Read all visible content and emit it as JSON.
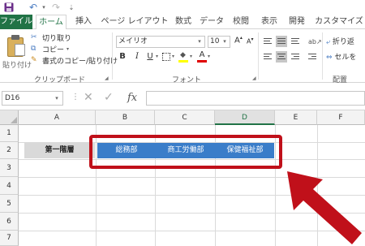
{
  "tabs": [
    {
      "label": "ファイル"
    },
    {
      "label": "ホーム"
    },
    {
      "label": "挿入"
    },
    {
      "label": "ページ レイアウト"
    },
    {
      "label": "数式"
    },
    {
      "label": "データ"
    },
    {
      "label": "校閲"
    },
    {
      "label": "表示"
    },
    {
      "label": "開発"
    },
    {
      "label": "カスタマイズ"
    }
  ],
  "clipboard": {
    "paste_label": "貼り付け",
    "cut_label": "切り取り",
    "copy_label": "コピー",
    "format_painter_label": "書式のコピー/貼り付け",
    "group_label": "クリップボード"
  },
  "font": {
    "name": "メイリオ",
    "size": "10",
    "grow": "A",
    "shrink": "A",
    "bold": "B",
    "italic": "I",
    "underline": "U",
    "color_letter": "A",
    "group_label": "フォント"
  },
  "alignment": {
    "wrap_label": "折り返",
    "merge_label": "セルを",
    "group_label": "配置"
  },
  "formula_bar": {
    "name_box": "D16",
    "cancel": "✕",
    "enter": "✓",
    "fx": "fx",
    "formula": ""
  },
  "grid": {
    "columns": [
      "A",
      "B",
      "C",
      "D",
      "E",
      "F"
    ],
    "rows": [
      "1",
      "2",
      "3",
      "4",
      "5",
      "6",
      "7"
    ],
    "cells": {
      "A2": "第一階層",
      "B2": "総務部",
      "C2": "商工労働部",
      "D2": "保健福祉部"
    }
  },
  "colors": {
    "accent": "#217346",
    "department_fill": "#3a7dc9",
    "label_fill": "#d9d9d9",
    "callout": "#c0101a"
  }
}
